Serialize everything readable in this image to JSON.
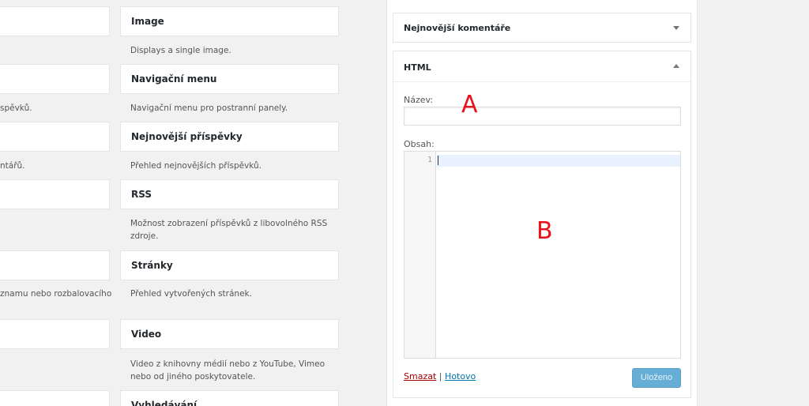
{
  "left_fragments": [
    "spěvků.",
    "ntářů.",
    "znamu nebo rozbalovacího"
  ],
  "widgets": [
    {
      "name": "Image",
      "description": "Displays a single image."
    },
    {
      "name": "Navigační menu",
      "description": "Navigační menu pro postranní panely."
    },
    {
      "name": "Nejnovější příspěvky",
      "description": "Přehled nejnovějších příspěvků."
    },
    {
      "name": "RSS",
      "description": "Možnost zobrazení příspěvků z libovolného RSS zdroje."
    },
    {
      "name": "Stránky",
      "description": "Přehled vytvořených stránek."
    },
    {
      "name": "Video",
      "description": "Video z knihovny médií nebo z YouTube, Vimeo nebo od jiného poskytovatele."
    },
    {
      "name": "Vyhledávání",
      "description": ""
    }
  ],
  "sidebar": {
    "collapsed_widget": {
      "title": "Nejnovější komentáře",
      "icon": "arrow-down-icon"
    },
    "open_widget": {
      "title": "HTML",
      "icon": "arrow-up-icon",
      "title_label": "Název:",
      "title_value": "",
      "content_label": "Obsah:",
      "line_number": "1",
      "delete_label": "Smazat",
      "separator": "|",
      "done_label": "Hotovo",
      "save_label": "Uloženo"
    }
  },
  "annotations": {
    "a": "A",
    "b": "B"
  },
  "colors": {
    "annotation": "#e8121a",
    "link": "#0073aa",
    "delete": "#a00000",
    "save_button": "#66aed5"
  }
}
